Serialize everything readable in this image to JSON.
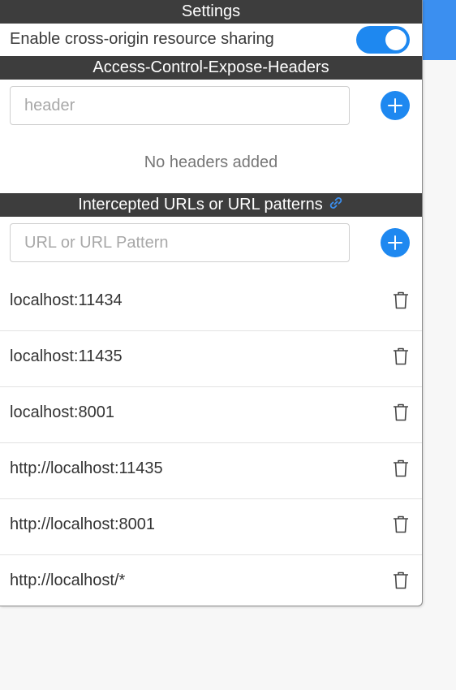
{
  "settings": {
    "title": "Settings",
    "cors_toggle": {
      "label": "Enable cross-origin resource sharing",
      "enabled": true,
      "color": "#1e88f0"
    }
  },
  "expose_headers": {
    "title": "Access-Control-Expose-Headers",
    "input_placeholder": "header",
    "empty_message": "No headers added"
  },
  "intercepted": {
    "title": "Intercepted URLs or URL patterns",
    "title_icon": "link-icon",
    "input_placeholder": "URL or URL Pattern",
    "urls": [
      "localhost:11434",
      "localhost:11435",
      "localhost:8001",
      "http://localhost:11435",
      "http://localhost:8001",
      "http://localhost/*"
    ]
  },
  "icons": {
    "add": "plus-icon",
    "delete": "trash-icon"
  },
  "colors": {
    "accent": "#1e88f0",
    "header_bg": "#3d3d3d"
  }
}
